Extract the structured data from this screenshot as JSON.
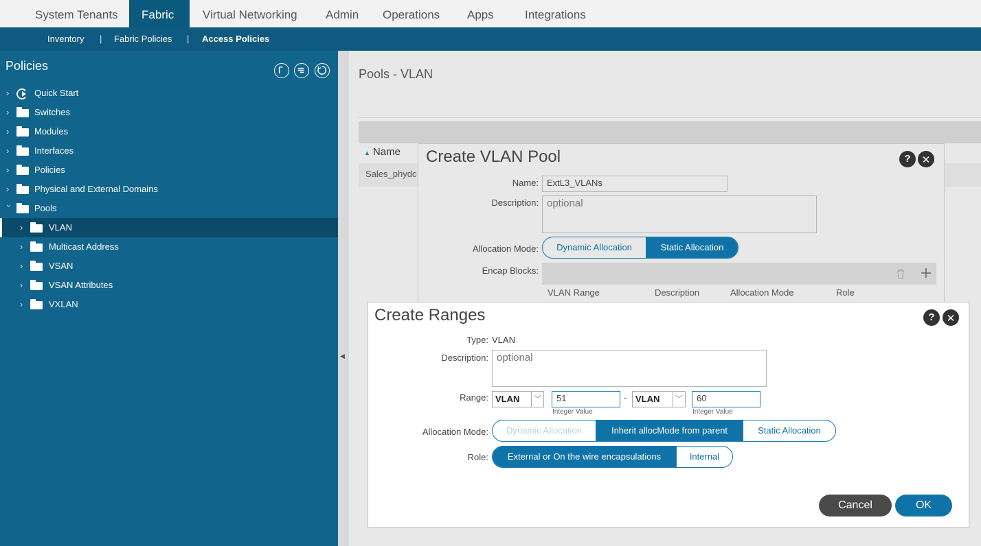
{
  "topnav": {
    "tabs": [
      {
        "label": "System"
      },
      {
        "label": "Tenants"
      },
      {
        "label": "Fabric"
      },
      {
        "label": "Virtual Networking"
      },
      {
        "label": "Admin"
      },
      {
        "label": "Operations"
      },
      {
        "label": "Apps"
      },
      {
        "label": "Integrations"
      }
    ],
    "active_tab": "Fabric"
  },
  "subnav": {
    "items": [
      {
        "label": "Inventory"
      },
      {
        "label": "Fabric Policies"
      },
      {
        "label": "Access Policies"
      }
    ],
    "separator": "|",
    "active_item": "Access Policies"
  },
  "sidebar": {
    "title": "Policies",
    "header_icons": [
      "quick-start-icon",
      "list-icon",
      "refresh-icon"
    ],
    "items": [
      {
        "label": "Quick Start",
        "icon": "quick-start-icon"
      },
      {
        "label": "Switches",
        "icon": "folder-icon"
      },
      {
        "label": "Modules",
        "icon": "folder-icon"
      },
      {
        "label": "Interfaces",
        "icon": "folder-icon"
      },
      {
        "label": "Policies",
        "icon": "folder-icon"
      },
      {
        "label": "Physical and External Domains",
        "icon": "folder-icon"
      },
      {
        "label": "Pools",
        "icon": "folder-icon",
        "expanded": true
      },
      {
        "label": "VLAN",
        "icon": "folder-icon",
        "selected": true
      },
      {
        "label": "Multicast Address",
        "icon": "folder-icon"
      },
      {
        "label": "VSAN",
        "icon": "folder-icon"
      },
      {
        "label": "VSAN Attributes",
        "icon": "folder-icon"
      },
      {
        "label": "VXLAN",
        "icon": "folder-icon"
      }
    ]
  },
  "main": {
    "title": "Pools - VLAN",
    "column_name": "Name",
    "row1": "Sales_phydc"
  },
  "vlan_pool_dialog": {
    "title": "Create VLAN Pool",
    "name_label": "Name:",
    "name_value": "ExtL3_VLANs",
    "description_label": "Description:",
    "description_placeholder": "optional",
    "allocation_label": "Allocation Mode:",
    "allocation_options": [
      "Dynamic Allocation",
      "Static Allocation"
    ],
    "allocation_selected": "Static Allocation",
    "encap_label": "Encap Blocks:",
    "columns": [
      "VLAN Range",
      "Description",
      "Allocation Mode",
      "Role"
    ]
  },
  "ranges_dialog": {
    "title": "Create Ranges",
    "type_label": "Type:",
    "type_value": "VLAN",
    "description_label": "Description:",
    "description_placeholder": "optional",
    "range_label": "Range:",
    "range_from_type": "VLAN",
    "range_from": "51",
    "range_dash": "-",
    "range_to_type": "VLAN",
    "range_to": "60",
    "range_hint": "Integer Value",
    "allocation_label": "Allocation Mode:",
    "allocation_options": [
      "Dynamic Allocation",
      "Inherit allocMode from parent",
      "Static Allocation"
    ],
    "allocation_selected": "Inherit allocMode from parent",
    "role_label": "Role:",
    "role_options": [
      "External or On the wire encapsulations",
      "Internal"
    ],
    "role_selected": "External or On the wire encapsulations",
    "cancel_label": "Cancel",
    "ok_label": "OK"
  },
  "colors": {
    "nav_active": "#0b5a7e",
    "subnav_bg": "#0f5a80",
    "sidebar_bg": "#11648c",
    "accent": "#0f73a8",
    "cancel_bg": "#4a4a4a"
  }
}
